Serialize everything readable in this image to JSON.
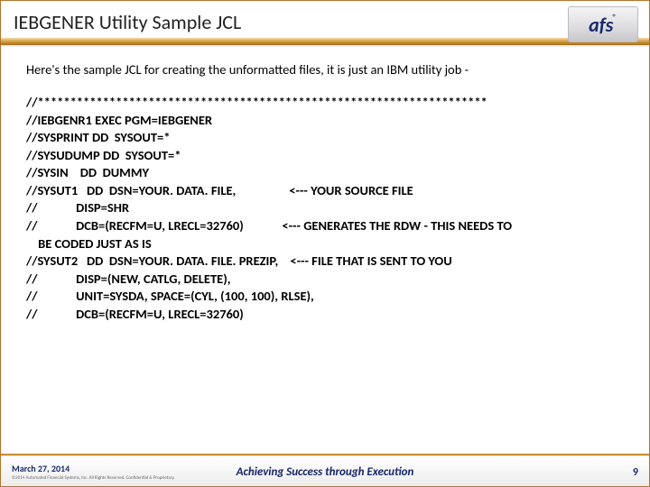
{
  "header": {
    "title": "IEBGENER Utility Sample JCL",
    "logo_text": "afs",
    "logo_reg": "®"
  },
  "content": {
    "intro": "Here's the sample JCL for creating the unformatted files, it is just an IBM utility job -",
    "code": "//*********************************************************************\n//IEBGENR1 EXEC PGM=IEBGENER\n//SYSPRINT DD  SYSOUT=*\n//SYSUDUMP DD  SYSOUT=*\n//SYSIN    DD  DUMMY\n//SYSUT1   DD  DSN=YOUR. DATA. FILE,                  <--- YOUR SOURCE FILE\n//             DISP=SHR\n//             DCB=(RECFM=U, LRECL=32760)             <--- GENERATES THE RDW - THIS NEEDS TO\n    BE CODED JUST AS IS\n//SYSUT2   DD  DSN=YOUR. DATA. FILE. PREZIP,    <--- FILE THAT IS SENT TO YOU\n//             DISP=(NEW, CATLG, DELETE),\n//             UNIT=SYSDA, SPACE=(CYL, (100, 100), RLSE),\n//             DCB=(RECFM=U, LRECL=32760)"
  },
  "footer": {
    "date": "March 27, 2014",
    "copyright": "©2014 Automated Financial Systems, Inc. All Rights Reserved. Confidential & Proprietary.",
    "tagline": "Achieving Success through Execution",
    "page_number": "9"
  }
}
